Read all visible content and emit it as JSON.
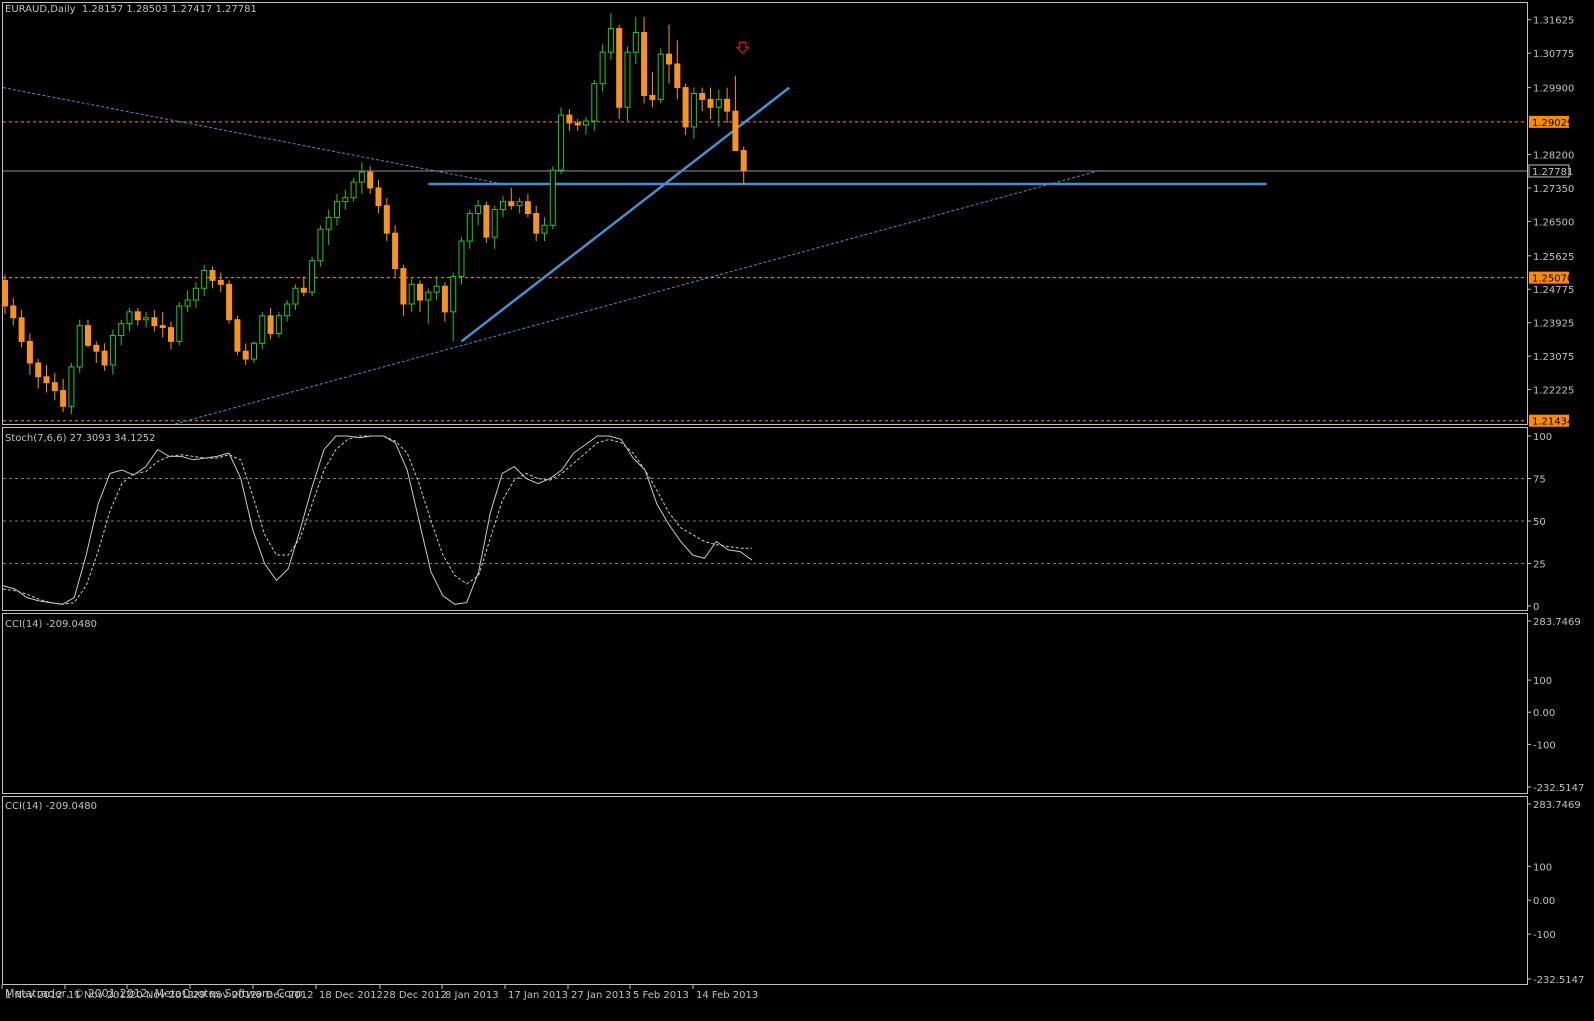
{
  "colors": {
    "background": "#000000",
    "frame": "#c0c0c0",
    "bull_candle": "#22c522",
    "bear_candle": "#f7931e",
    "level_line": "#ff8c00",
    "trend_line": "#4a8ccc",
    "current_price_line": "#c0c0c0",
    "sell_arrow": "#cc1a1a",
    "indicator_line": "#c8c8c8",
    "level_dash": "#7a7a7a"
  },
  "main": {
    "title": "EURAUD,Daily  1.28157 1.28503 1.27417 1.27781",
    "price_ticks": [
      "1.31625",
      "1.30775",
      "1.29900",
      "1.28200",
      "1.27350",
      "1.26500",
      "1.25625",
      "1.24775",
      "1.23925",
      "1.23075",
      "1.22225"
    ],
    "level_labels": [
      "1.29029",
      "1.25070",
      "1.21434"
    ],
    "current_price": "1.27781",
    "sell_arrow_icon": "down-arrow-icon"
  },
  "stoch": {
    "title": "Stoch(7,6,6) 27.3093 34.1252",
    "ticks": [
      "100",
      "75",
      "50",
      "25",
      "0"
    ]
  },
  "cci1": {
    "title": "CCI(14) -209.0480",
    "ticks": [
      "283.7469",
      "100",
      "0.00",
      "-100",
      "-232.5147"
    ]
  },
  "cci2": {
    "title": "CCI(14) -209.0480",
    "ticks": [
      "283.7469",
      "100",
      "0.00",
      "-100",
      "-232.5147"
    ]
  },
  "time_axis": [
    "1 Nov 2012",
    "11 Nov 2012",
    "20 Nov 2012",
    "29 Nov 2012",
    "9 Dec 2012",
    "18 Dec 2012",
    "28 Dec 2012",
    "8 Jan 2013",
    "17 Jan 2013",
    "27 Jan 2013",
    "5 Feb 2013",
    "14 Feb 2013"
  ],
  "footer": {
    "copyright": "Metatrader, © 2001-2012, MetaQuotes Software Corp."
  },
  "chart_data": [
    {
      "type": "candlestick",
      "title": "EURAUD,Daily",
      "ylim": [
        1.2135,
        1.3205
      ],
      "levels": [
        1.29029,
        1.2507,
        1.21434
      ],
      "current_price": 1.27781,
      "support_level": 1.2745,
      "candles": [
        {
          "o": 1.25,
          "h": 1.2515,
          "l": 1.2415,
          "c": 1.2435
        },
        {
          "o": 1.2435,
          "h": 1.2455,
          "l": 1.2385,
          "c": 1.2405
        },
        {
          "o": 1.2405,
          "h": 1.2425,
          "l": 1.233,
          "c": 1.2345
        },
        {
          "o": 1.2345,
          "h": 1.2365,
          "l": 1.226,
          "c": 1.229
        },
        {
          "o": 1.229,
          "h": 1.23,
          "l": 1.2225,
          "c": 1.2255
        },
        {
          "o": 1.2255,
          "h": 1.2285,
          "l": 1.2215,
          "c": 1.224
        },
        {
          "o": 1.224,
          "h": 1.2265,
          "l": 1.2195,
          "c": 1.222
        },
        {
          "o": 1.222,
          "h": 1.225,
          "l": 1.2165,
          "c": 1.218
        },
        {
          "o": 1.218,
          "h": 1.229,
          "l": 1.216,
          "c": 1.228
        },
        {
          "o": 1.228,
          "h": 1.24,
          "l": 1.2265,
          "c": 1.2385
        },
        {
          "o": 1.2385,
          "h": 1.24,
          "l": 1.233,
          "c": 1.2335
        },
        {
          "o": 1.2335,
          "h": 1.2345,
          "l": 1.229,
          "c": 1.232
        },
        {
          "o": 1.232,
          "h": 1.234,
          "l": 1.227,
          "c": 1.2285
        },
        {
          "o": 1.2285,
          "h": 1.2375,
          "l": 1.226,
          "c": 1.236
        },
        {
          "o": 1.236,
          "h": 1.24,
          "l": 1.2335,
          "c": 1.239
        },
        {
          "o": 1.239,
          "h": 1.243,
          "l": 1.237,
          "c": 1.242
        },
        {
          "o": 1.242,
          "h": 1.243,
          "l": 1.2385,
          "c": 1.24
        },
        {
          "o": 1.24,
          "h": 1.242,
          "l": 1.238,
          "c": 1.2405
        },
        {
          "o": 1.2405,
          "h": 1.2425,
          "l": 1.237,
          "c": 1.2385
        },
        {
          "o": 1.2385,
          "h": 1.242,
          "l": 1.2355,
          "c": 1.238
        },
        {
          "o": 1.238,
          "h": 1.2395,
          "l": 1.2325,
          "c": 1.2345
        },
        {
          "o": 1.2345,
          "h": 1.2445,
          "l": 1.2335,
          "c": 1.2435
        },
        {
          "o": 1.2435,
          "h": 1.2475,
          "l": 1.242,
          "c": 1.245
        },
        {
          "o": 1.245,
          "h": 1.2495,
          "l": 1.243,
          "c": 1.248
        },
        {
          "o": 1.248,
          "h": 1.254,
          "l": 1.246,
          "c": 1.2525
        },
        {
          "o": 1.2525,
          "h": 1.2535,
          "l": 1.248,
          "c": 1.25
        },
        {
          "o": 1.25,
          "h": 1.252,
          "l": 1.247,
          "c": 1.249
        },
        {
          "o": 1.249,
          "h": 1.25,
          "l": 1.239,
          "c": 1.24
        },
        {
          "o": 1.24,
          "h": 1.241,
          "l": 1.231,
          "c": 1.232
        },
        {
          "o": 1.232,
          "h": 1.234,
          "l": 1.2285,
          "c": 1.23
        },
        {
          "o": 1.23,
          "h": 1.2345,
          "l": 1.229,
          "c": 1.234
        },
        {
          "o": 1.234,
          "h": 1.242,
          "l": 1.2325,
          "c": 1.241
        },
        {
          "o": 1.241,
          "h": 1.243,
          "l": 1.235,
          "c": 1.2365
        },
        {
          "o": 1.2365,
          "h": 1.242,
          "l": 1.2355,
          "c": 1.241
        },
        {
          "o": 1.241,
          "h": 1.245,
          "l": 1.2395,
          "c": 1.244
        },
        {
          "o": 1.244,
          "h": 1.249,
          "l": 1.2425,
          "c": 1.248
        },
        {
          "o": 1.248,
          "h": 1.251,
          "l": 1.246,
          "c": 1.247
        },
        {
          "o": 1.247,
          "h": 1.256,
          "l": 1.246,
          "c": 1.255
        },
        {
          "o": 1.255,
          "h": 1.264,
          "l": 1.2535,
          "c": 1.263
        },
        {
          "o": 1.263,
          "h": 1.268,
          "l": 1.259,
          "c": 1.266
        },
        {
          "o": 1.266,
          "h": 1.272,
          "l": 1.264,
          "c": 1.27
        },
        {
          "o": 1.27,
          "h": 1.273,
          "l": 1.268,
          "c": 1.271
        },
        {
          "o": 1.271,
          "h": 1.276,
          "l": 1.27,
          "c": 1.275
        },
        {
          "o": 1.275,
          "h": 1.28,
          "l": 1.272,
          "c": 1.2775
        },
        {
          "o": 1.2775,
          "h": 1.279,
          "l": 1.272,
          "c": 1.2735
        },
        {
          "o": 1.2735,
          "h": 1.2755,
          "l": 1.267,
          "c": 1.269
        },
        {
          "o": 1.269,
          "h": 1.271,
          "l": 1.26,
          "c": 1.262
        },
        {
          "o": 1.262,
          "h": 1.264,
          "l": 1.251,
          "c": 1.253
        },
        {
          "o": 1.253,
          "h": 1.254,
          "l": 1.241,
          "c": 1.244
        },
        {
          "o": 1.244,
          "h": 1.2505,
          "l": 1.242,
          "c": 1.249
        },
        {
          "o": 1.249,
          "h": 1.25,
          "l": 1.242,
          "c": 1.245
        },
        {
          "o": 1.245,
          "h": 1.248,
          "l": 1.239,
          "c": 1.247
        },
        {
          "o": 1.247,
          "h": 1.251,
          "l": 1.245,
          "c": 1.2485
        },
        {
          "o": 1.2485,
          "h": 1.2495,
          "l": 1.2395,
          "c": 1.242
        },
        {
          "o": 1.242,
          "h": 1.252,
          "l": 1.2345,
          "c": 1.251
        },
        {
          "o": 1.251,
          "h": 1.261,
          "l": 1.249,
          "c": 1.26
        },
        {
          "o": 1.26,
          "h": 1.268,
          "l": 1.258,
          "c": 1.267
        },
        {
          "o": 1.267,
          "h": 1.2705,
          "l": 1.264,
          "c": 1.269
        },
        {
          "o": 1.269,
          "h": 1.27,
          "l": 1.2595,
          "c": 1.261
        },
        {
          "o": 1.261,
          "h": 1.269,
          "l": 1.258,
          "c": 1.268
        },
        {
          "o": 1.268,
          "h": 1.2715,
          "l": 1.266,
          "c": 1.27
        },
        {
          "o": 1.27,
          "h": 1.2735,
          "l": 1.268,
          "c": 1.269
        },
        {
          "o": 1.269,
          "h": 1.271,
          "l": 1.267,
          "c": 1.27
        },
        {
          "o": 1.27,
          "h": 1.272,
          "l": 1.266,
          "c": 1.267
        },
        {
          "o": 1.267,
          "h": 1.269,
          "l": 1.26,
          "c": 1.262
        },
        {
          "o": 1.262,
          "h": 1.266,
          "l": 1.26,
          "c": 1.264
        },
        {
          "o": 1.264,
          "h": 1.279,
          "l": 1.263,
          "c": 1.278
        },
        {
          "o": 1.278,
          "h": 1.294,
          "l": 1.277,
          "c": 1.292
        },
        {
          "o": 1.292,
          "h": 1.2935,
          "l": 1.288,
          "c": 1.29
        },
        {
          "o": 1.29,
          "h": 1.291,
          "l": 1.288,
          "c": 1.2895
        },
        {
          "o": 1.2895,
          "h": 1.2915,
          "l": 1.287,
          "c": 1.2905
        },
        {
          "o": 1.2905,
          "h": 1.301,
          "l": 1.288,
          "c": 1.3
        },
        {
          "o": 1.3,
          "h": 1.31,
          "l": 1.298,
          "c": 1.308
        },
        {
          "o": 1.308,
          "h": 1.318,
          "l": 1.306,
          "c": 1.314
        },
        {
          "o": 1.314,
          "h": 1.315,
          "l": 1.291,
          "c": 1.294
        },
        {
          "o": 1.294,
          "h": 1.3095,
          "l": 1.2905,
          "c": 1.308
        },
        {
          "o": 1.308,
          "h": 1.317,
          "l": 1.305,
          "c": 1.313
        },
        {
          "o": 1.313,
          "h": 1.317,
          "l": 1.295,
          "c": 1.297
        },
        {
          "o": 1.297,
          "h": 1.303,
          "l": 1.294,
          "c": 1.296
        },
        {
          "o": 1.296,
          "h": 1.309,
          "l": 1.295,
          "c": 1.3075
        },
        {
          "o": 1.3075,
          "h": 1.315,
          "l": 1.3,
          "c": 1.305
        },
        {
          "o": 1.305,
          "h": 1.311,
          "l": 1.296,
          "c": 1.299
        },
        {
          "o": 1.299,
          "h": 1.3,
          "l": 1.287,
          "c": 1.289
        },
        {
          "o": 1.289,
          "h": 1.299,
          "l": 1.286,
          "c": 1.2975
        },
        {
          "o": 1.2975,
          "h": 1.299,
          "l": 1.293,
          "c": 1.296
        },
        {
          "o": 1.296,
          "h": 1.299,
          "l": 1.291,
          "c": 1.294
        },
        {
          "o": 1.294,
          "h": 1.2985,
          "l": 1.289,
          "c": 1.296
        },
        {
          "o": 1.296,
          "h": 1.299,
          "l": 1.29,
          "c": 1.293
        },
        {
          "o": 1.293,
          "h": 1.302,
          "l": 1.285,
          "c": 1.283
        },
        {
          "o": 1.283,
          "h": 1.284,
          "l": 1.2742,
          "c": 1.2778
        }
      ]
    },
    {
      "type": "line",
      "title": "Stoch(7,6,6)",
      "ylim": [
        0,
        100
      ],
      "levels": [
        25,
        50,
        75
      ],
      "series": [
        {
          "name": "",
          "style": "solid",
          "values": [
            12,
            10,
            5,
            3,
            2,
            1,
            5,
            30,
            60,
            78,
            80,
            77,
            82,
            92,
            88,
            88,
            86,
            87,
            88,
            90,
            75,
            45,
            25,
            15,
            22,
            45,
            70,
            92,
            100,
            100,
            99,
            100,
            100,
            96,
            80,
            50,
            20,
            6,
            1,
            2,
            20,
            55,
            78,
            82,
            75,
            72,
            75,
            80,
            90,
            95,
            100,
            100,
            98,
            87,
            80,
            60,
            48,
            38,
            30,
            28,
            38,
            33,
            32,
            27
          ]
        },
        {
          "name": "",
          "style": "dashed",
          "values": [
            10,
            9,
            7,
            4,
            2,
            1,
            2,
            12,
            32,
            56,
            72,
            78,
            79,
            85,
            88,
            89,
            88,
            87,
            87,
            89,
            86,
            65,
            42,
            30,
            30,
            40,
            60,
            80,
            92,
            98,
            100,
            100,
            100,
            97,
            90,
            72,
            50,
            30,
            18,
            13,
            18,
            40,
            62,
            74,
            78,
            75,
            74,
            78,
            84,
            90,
            96,
            98,
            96,
            90,
            80,
            68,
            55,
            46,
            42,
            38,
            36,
            35,
            34,
            34
          ]
        }
      ]
    },
    {
      "type": "line",
      "title": "CCI(14)",
      "ylim": [
        -232.5147,
        283.7469
      ],
      "levels": [
        100,
        0,
        -100
      ],
      "series": []
    },
    {
      "type": "line",
      "title": "CCI(14)",
      "ylim": [
        -232.5147,
        283.7469
      ],
      "levels": [
        100,
        0,
        -100
      ],
      "series": []
    }
  ]
}
